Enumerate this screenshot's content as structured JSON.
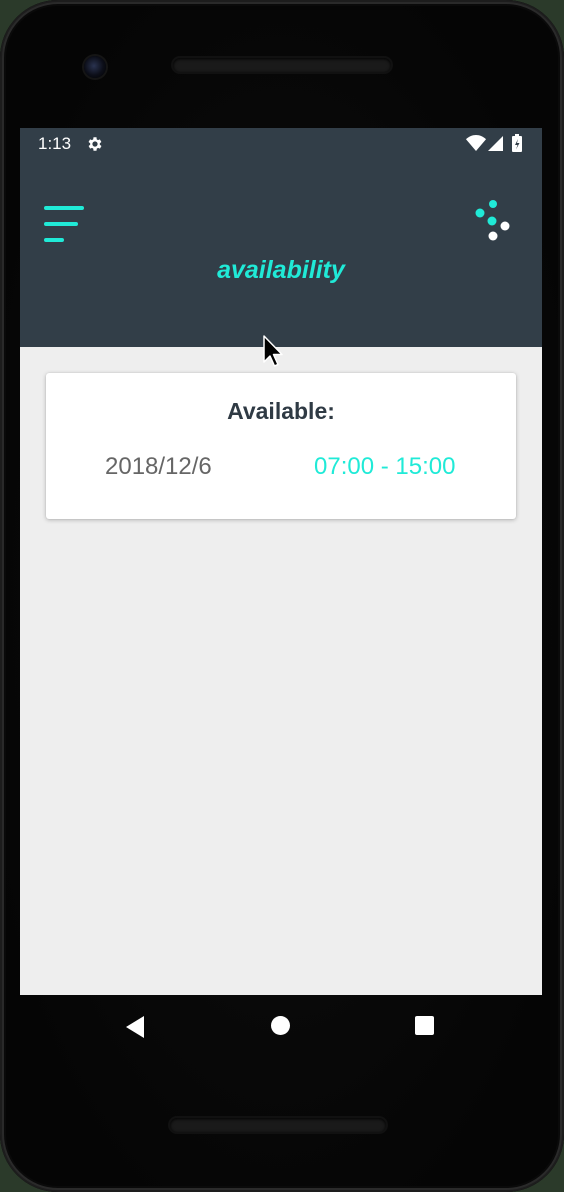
{
  "status_bar": {
    "time": "1:13",
    "icons": [
      "gear-icon",
      "wifi-icon",
      "cell-signal-icon",
      "battery-icon"
    ]
  },
  "app_bar": {
    "title": "availability",
    "menu_icon": "hamburger-menu-icon",
    "action_icon": "dots-icon"
  },
  "availability_card": {
    "heading": "Available:",
    "entries": [
      {
        "date": "2018/12/6",
        "time_range": "07:00 - 15:00"
      }
    ]
  },
  "navigation_bar": {
    "buttons": [
      "back-icon",
      "home-icon",
      "recents-icon"
    ]
  },
  "colors": {
    "accent": "#20ead7",
    "toolbar": "#323e48",
    "background": "#eeeeee",
    "card": "#ffffff",
    "heading_text": "#2f3a44",
    "date_text": "#666666"
  }
}
